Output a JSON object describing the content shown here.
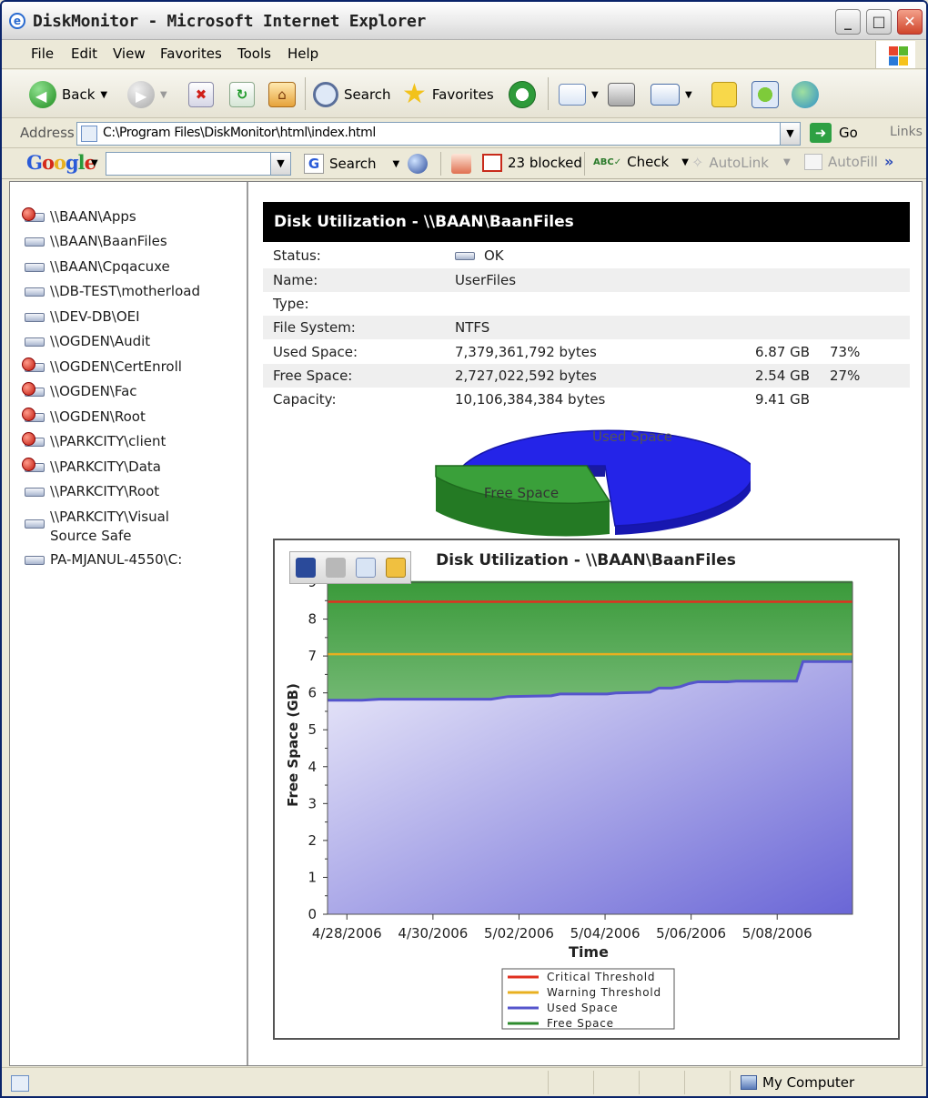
{
  "window": {
    "title": "DiskMonitor - Microsoft Internet Explorer",
    "buttons": {
      "minimize": "_",
      "maximize": "□",
      "close": "✕"
    }
  },
  "menu": [
    "File",
    "Edit",
    "View",
    "Favorites",
    "Tools",
    "Help"
  ],
  "toolbar": {
    "back": "Back",
    "search": "Search",
    "favorites": "Favorites"
  },
  "address": {
    "label": "Address",
    "url": "C:\\Program Files\\DiskMonitor\\html\\index.html",
    "go": "Go",
    "links": "Links"
  },
  "google": {
    "logo": "Google",
    "search": "Search",
    "blocked": "23 blocked",
    "check": "Check",
    "autolink": "AutoLink",
    "autofill": "AutoFill",
    "more": "»"
  },
  "shares": [
    {
      "name": "\\\\BAAN\\Apps",
      "alert": true
    },
    {
      "name": "\\\\BAAN\\BaanFiles",
      "alert": false
    },
    {
      "name": "\\\\BAAN\\Cpqacuxe",
      "alert": false
    },
    {
      "name": "\\\\DB-TEST\\motherload",
      "alert": false
    },
    {
      "name": "\\\\DEV-DB\\OEI",
      "alert": false
    },
    {
      "name": "\\\\OGDEN\\Audit",
      "alert": false
    },
    {
      "name": "\\\\OGDEN\\CertEnroll",
      "alert": true
    },
    {
      "name": "\\\\OGDEN\\Fac",
      "alert": true
    },
    {
      "name": "\\\\OGDEN\\Root",
      "alert": true
    },
    {
      "name": "\\\\PARKCITY\\client",
      "alert": true
    },
    {
      "name": "\\\\PARKCITY\\Data",
      "alert": true
    },
    {
      "name": "\\\\PARKCITY\\Root",
      "alert": false
    },
    {
      "name": "\\\\PARKCITY\\Visual Source Safe",
      "alert": false
    },
    {
      "name": "PA-MJANUL-4550\\C:",
      "alert": false
    }
  ],
  "detail": {
    "title": "Disk Utilization - \\\\BAAN\\BaanFiles",
    "status_label": "Status:",
    "status_value": "OK",
    "name_label": "Name:",
    "name_value": "UserFiles",
    "type_label": "Type:",
    "type_value": "",
    "fs_label": "File System:",
    "fs_value": "NTFS",
    "used_label": "Used Space:",
    "used_bytes": "7,379,361,792 bytes",
    "used_gb": "6.87 GB",
    "used_pct": "73%",
    "free_label": "Free Space:",
    "free_bytes": "2,727,022,592 bytes",
    "free_gb": "2.54 GB",
    "free_pct": "27%",
    "cap_label": "Capacity:",
    "cap_bytes": "10,106,384,384 bytes",
    "cap_gb": "9.41 GB"
  },
  "pie_chart": {
    "slices": [
      {
        "label": "Used Space",
        "percent": 73,
        "color": "#2a2ae6"
      },
      {
        "label": "Free Space",
        "percent": 27,
        "color": "#3a9a3a"
      }
    ]
  },
  "chart_data": {
    "type": "area",
    "title": "Disk Utilization - \\\\BAAN\\BaanFiles",
    "xlabel": "Time",
    "ylabel": "Free Space (GB)",
    "ylim": [
      0,
      9
    ],
    "yticks": [
      0,
      1,
      2,
      3,
      4,
      5,
      6,
      7,
      8,
      9
    ],
    "x_tick_labels": [
      "4/28/2006",
      "4/30/2006",
      "5/02/2006",
      "5/04/2006",
      "5/06/2006",
      "5/08/2006"
    ],
    "xlim_days": [
      0,
      12.2
    ],
    "critical_threshold": 8.47,
    "warning_threshold": 7.05,
    "capacity": 9.0,
    "used_space": [
      [
        0,
        5.8
      ],
      [
        0.8,
        5.8
      ],
      [
        1.2,
        5.83
      ],
      [
        3.8,
        5.83
      ],
      [
        4.2,
        5.9
      ],
      [
        5.2,
        5.92
      ],
      [
        5.4,
        5.97
      ],
      [
        6.5,
        5.97
      ],
      [
        6.7,
        6.0
      ],
      [
        7.5,
        6.02
      ],
      [
        7.7,
        6.13
      ],
      [
        8.0,
        6.13
      ],
      [
        8.2,
        6.17
      ],
      [
        8.4,
        6.25
      ],
      [
        8.6,
        6.3
      ],
      [
        9.3,
        6.3
      ],
      [
        9.5,
        6.32
      ],
      [
        10.9,
        6.32
      ],
      [
        11.05,
        6.85
      ],
      [
        12.2,
        6.85
      ]
    ],
    "legend": [
      "Critical Threshold",
      "Warning Threshold",
      "Used Space",
      "Free Space"
    ],
    "colors": {
      "critical": "#e03020",
      "warning": "#e8b020",
      "used": "#5555cc",
      "free": "#2e8b2e"
    }
  },
  "status_bar": {
    "zone": "My Computer"
  }
}
